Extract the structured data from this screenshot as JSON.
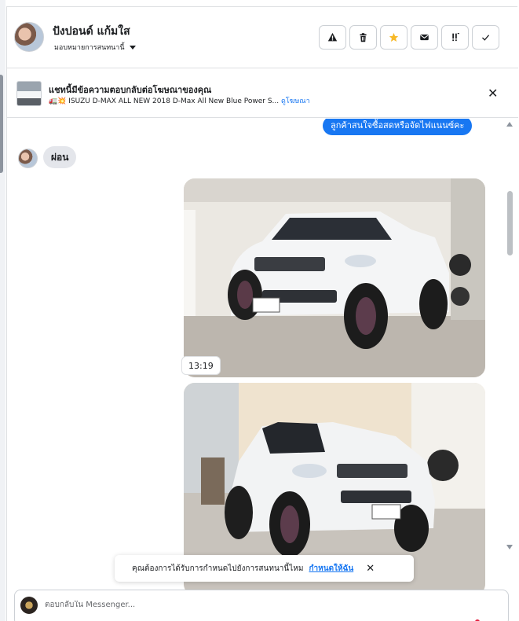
{
  "contact": {
    "name": "ปังปอนด์ แก้มใส",
    "assign_label": "มอบหมายการสนทนานี้"
  },
  "toolbar": {
    "icons": [
      "warning-icon",
      "trash-icon",
      "star-icon",
      "envelope-icon",
      "follow-up-icon",
      "check-icon"
    ],
    "star_color": "#f7b928"
  },
  "ad_banner": {
    "title": "แชทนี้มีข้อความตอบกลับต่อโฆษณาของคุณ",
    "emoji": "🚛💥",
    "ad_text": "ISUZU D-MAX ALL NEW 2018 D-Max All New Blue Power S...",
    "link": "ดูโฆษณา"
  },
  "messages": {
    "outgoing_text": "ลูกค้าสนใจซื้อสดหรือจัดไฟแนนซ์คะ",
    "incoming_text": "ผ่อน",
    "timestamp": "13:19",
    "photo1_plate": "2ขบ 9555",
    "photo1_brand": "ISUZU",
    "photo2_plate": "2ขบ 8555",
    "photo2_brand": "ISUZU"
  },
  "toast": {
    "text": "คุณต้องการได้รับการกำหนดไปยังการสนทนานี้ไหม",
    "link": "กำหนดให้ฉัน"
  },
  "composer": {
    "placeholder": "ตอบกลับใน Messenger..."
  },
  "colors": {
    "accent": "#1877f2",
    "bubble_incoming": "#e4e6eb",
    "notification_dot": "#e41e3f"
  }
}
